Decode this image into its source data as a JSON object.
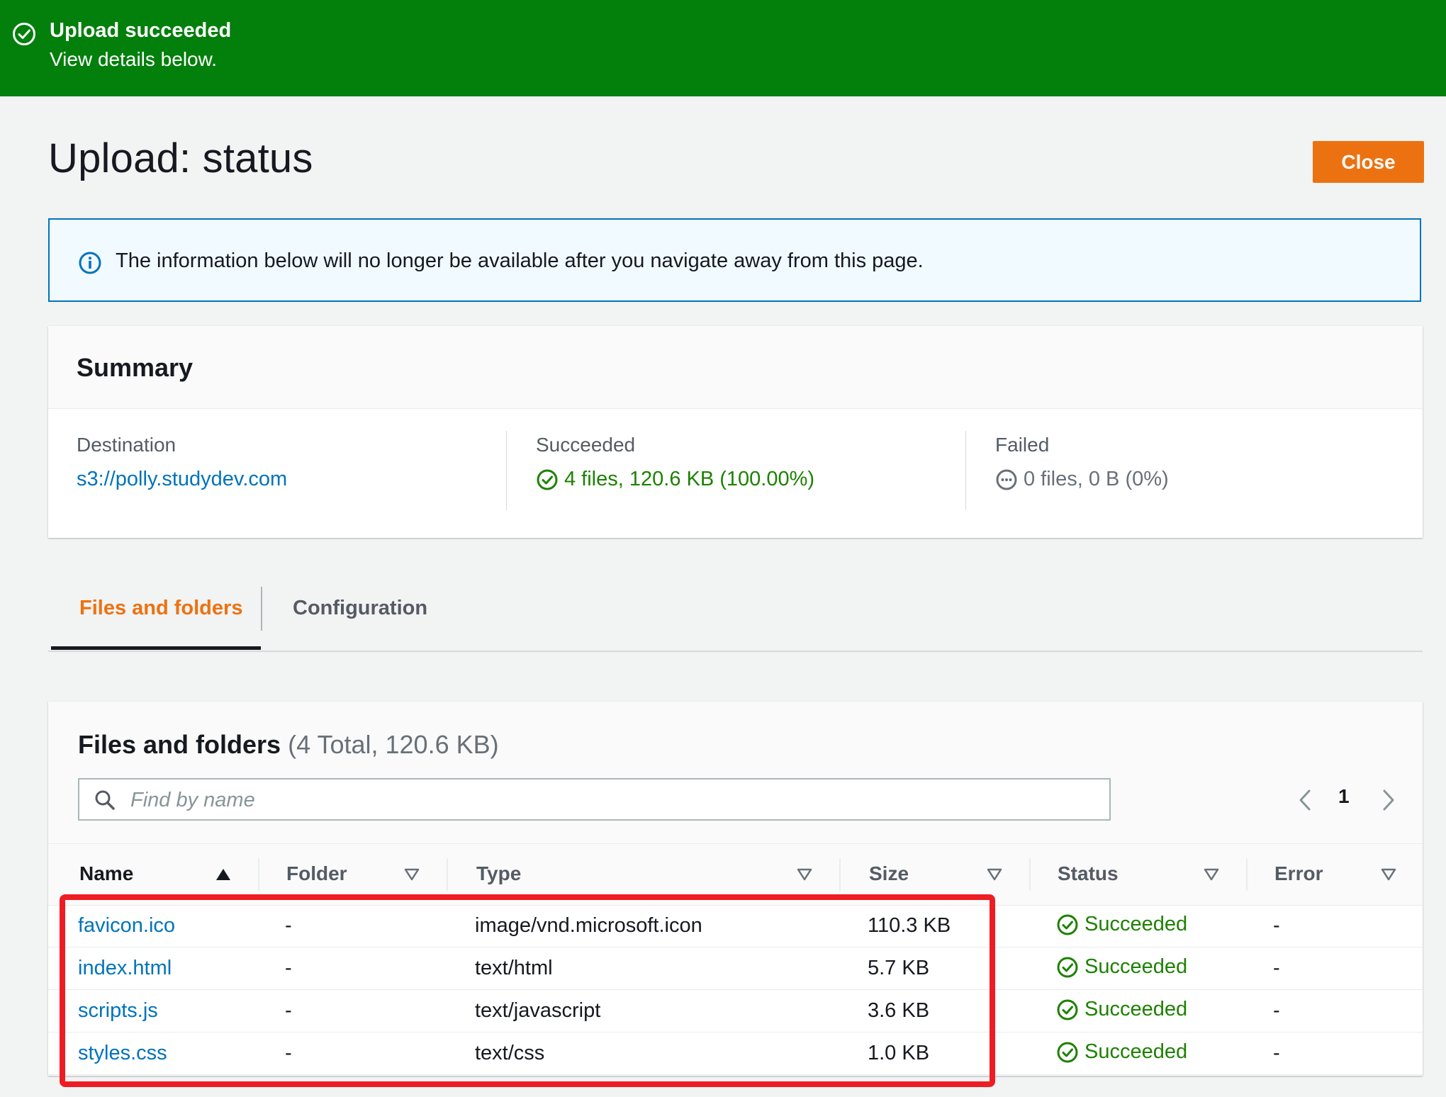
{
  "flash": {
    "title": "Upload succeeded",
    "subtitle": "View details below.",
    "icon": "check-circle-icon",
    "color": "#037f0c"
  },
  "header": {
    "title": "Upload: status",
    "close_label": "Close",
    "accent": "#ec7211"
  },
  "info": {
    "icon": "info-icon",
    "text": "The information below will no longer be available after you navigate away from this page."
  },
  "summary": {
    "title": "Summary",
    "destination": {
      "label": "Destination",
      "value": "s3://polly.studydev.com"
    },
    "succeeded": {
      "label": "Succeeded",
      "value": "4 files, 120.6 KB (100.00%)",
      "icon": "check-circle-icon"
    },
    "failed": {
      "label": "Failed",
      "value": "0 files, 0 B (0%)",
      "icon": "pending-circle-icon"
    }
  },
  "tabs": [
    {
      "label": "Files and folders",
      "active": true
    },
    {
      "label": "Configuration",
      "active": false
    }
  ],
  "files": {
    "title": "Files and folders",
    "count": "(4 Total, 120.6 KB)",
    "search_placeholder": "Find by name",
    "page": "1",
    "columns": [
      "Name",
      "Folder",
      "Type",
      "Size",
      "Status",
      "Error"
    ],
    "rows": [
      {
        "name": "favicon.ico",
        "folder": "-",
        "type": "image/vnd.microsoft.icon",
        "size": "110.3 KB",
        "status": "Succeeded",
        "error": "-"
      },
      {
        "name": "index.html",
        "folder": "-",
        "type": "text/html",
        "size": "5.7 KB",
        "status": "Succeeded",
        "error": "-"
      },
      {
        "name": "scripts.js",
        "folder": "-",
        "type": "text/javascript",
        "size": "3.6 KB",
        "status": "Succeeded",
        "error": "-"
      },
      {
        "name": "styles.css",
        "folder": "-",
        "type": "text/css",
        "size": "1.0 KB",
        "status": "Succeeded",
        "error": "-"
      }
    ]
  }
}
